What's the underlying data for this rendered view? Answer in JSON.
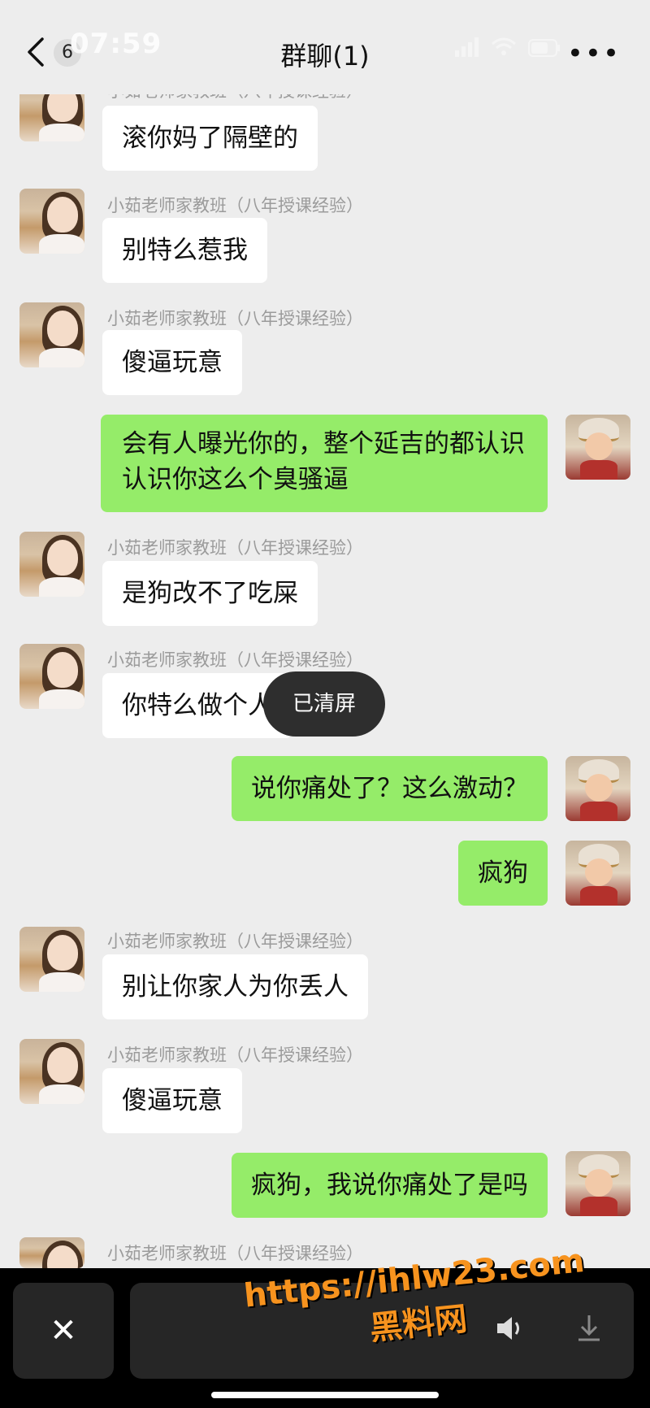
{
  "status_bar": {
    "time": "07:59"
  },
  "header": {
    "back_count": "6",
    "title": "群聊(1)",
    "more": "•••"
  },
  "sender_name": "小茹老师家教班（八年授课经验）",
  "messages": [
    {
      "side": "left",
      "text": "滚你妈了隔壁的"
    },
    {
      "side": "left",
      "text": "别特么惹我"
    },
    {
      "side": "left",
      "text": "傻逼玩意"
    },
    {
      "side": "right",
      "text": "会有人曝光你的，整个延吉的都认识认识你这么个臭骚逼"
    },
    {
      "side": "left",
      "text": "是狗改不了吃屎"
    },
    {
      "side": "left",
      "text": "你特么做个人"
    },
    {
      "side": "right",
      "text": "说你痛处了？这么激动？"
    },
    {
      "side": "right",
      "text": "疯狗"
    },
    {
      "side": "left",
      "text": "别让你家人为你丢人"
    },
    {
      "side": "left",
      "text": "傻逼玩意"
    },
    {
      "side": "right",
      "text": "疯狗，我说你痛处了是吗"
    }
  ],
  "toast": "已清屏",
  "bottom_bar": {
    "close_icon": "close-icon",
    "volume_icon": "volume-icon",
    "download_icon": "download-icon"
  },
  "watermark": {
    "url": "https://ihlw23.com",
    "site": "黑料网"
  }
}
